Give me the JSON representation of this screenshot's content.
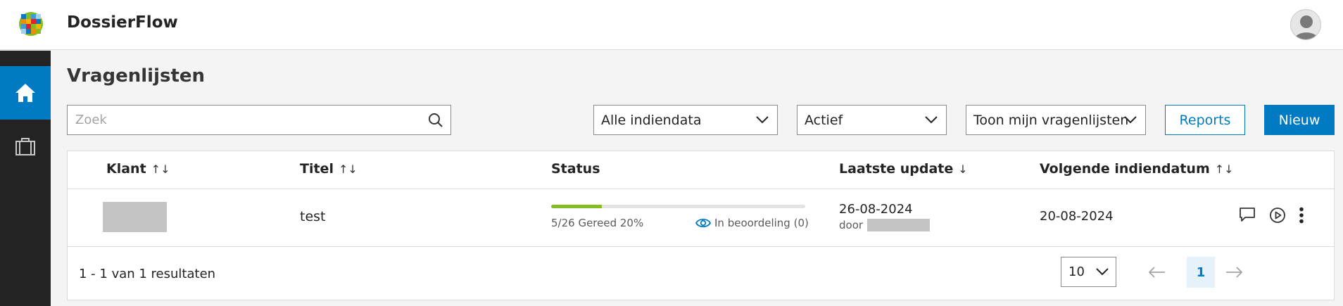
{
  "app": {
    "name": "DossierFlow"
  },
  "nav": {
    "home_icon": "home-icon",
    "cases_icon": "briefcase-icon"
  },
  "page": {
    "title": "Vragenlijsten"
  },
  "search": {
    "placeholder": "Zoek",
    "value": ""
  },
  "filters": {
    "dates": "Alle indiendata",
    "state": "Actief",
    "scope": "Toon mijn vragenlijsten"
  },
  "actions": {
    "reports": "Reports",
    "new": "Nieuw"
  },
  "table": {
    "columns": {
      "klant": "Klant",
      "titel": "Titel",
      "status": "Status",
      "laatste_update": "Laatste update",
      "volgende": "Volgende indiendatum"
    },
    "rows": [
      {
        "titel": "test",
        "progress_percent": 20,
        "progress_text": "5/26 Gereed 20%",
        "review_text": "In beoordeling (0)",
        "updated_date": "26-08-2024",
        "updated_by_prefix": "door",
        "next_date": "20-08-2024"
      }
    ]
  },
  "footer": {
    "results": "1 - 1 van 1 resultaten",
    "page_size": "10",
    "current_page": "1"
  },
  "colors": {
    "accent": "#007ac3",
    "progress": "#85bc20",
    "sidebar": "#232323"
  }
}
